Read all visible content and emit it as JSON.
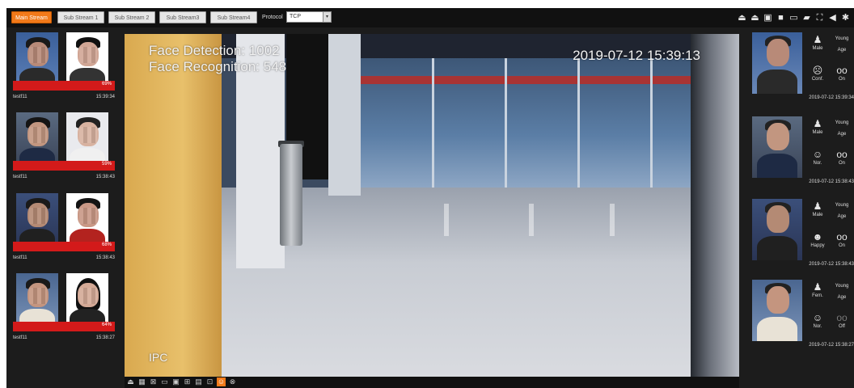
{
  "toolbar": {
    "tabs": [
      "Main Stream",
      "Sub Stream 1",
      "Sub Stream 2",
      "Sub Stream3",
      "Sub Stream4"
    ],
    "protocol_label": "Protocol",
    "protocol_value": "TCP"
  },
  "colors": {
    "accent": "#f27a1a",
    "similarity_bar": "#d31a1a"
  },
  "left_cards": [
    {
      "similarity": "69%",
      "name": "testf11",
      "time": "15:39:34"
    },
    {
      "similarity": "59%",
      "name": "testf11",
      "time": "15:38:43"
    },
    {
      "similarity": "68%",
      "name": "testf11",
      "time": "15:38:43"
    },
    {
      "similarity": "64%",
      "name": "testf11",
      "time": "15:38:27"
    }
  ],
  "video": {
    "face_detection": "Face Detection: 1002",
    "face_recognition": "Face Recognition: 548",
    "timestamp": "2019-07-12 15:39:13",
    "channel": "IPC"
  },
  "right_cards": [
    {
      "gender": "Male",
      "age_label": "Age",
      "age": "Young",
      "expression": "Conf.",
      "glasses": "On",
      "time": "2019-07-12 15:39:34"
    },
    {
      "gender": "Male",
      "age_label": "Age",
      "age": "Young",
      "expression": "Nor.",
      "glasses": "On",
      "time": "2019-07-12 15:38:43"
    },
    {
      "gender": "Male",
      "age_label": "Age",
      "age": "Young",
      "expression": "Happy",
      "glasses": "On",
      "time": "2019-07-12 15:38:43"
    },
    {
      "gender": "Fem.",
      "age_label": "Age",
      "age": "Young",
      "expression": "Nor.",
      "glasses": "Off",
      "time": "2019-07-12 15:38:27"
    }
  ],
  "icons": {
    "toolbar_right": [
      "audio-icon",
      "talk-icon",
      "zoom-icon",
      "fullscreen-icon",
      "snapshot-icon",
      "record-icon",
      "fit-icon",
      "sound-icon",
      "settings-icon"
    ],
    "bottom_bar": [
      "relay-icon",
      "ptz-icon",
      "fisheye-icon",
      "ratio-icon",
      "original-icon",
      "zoom-in-icon",
      "capture-icon",
      "rule-icon",
      "face-icon",
      "close-icon"
    ]
  }
}
